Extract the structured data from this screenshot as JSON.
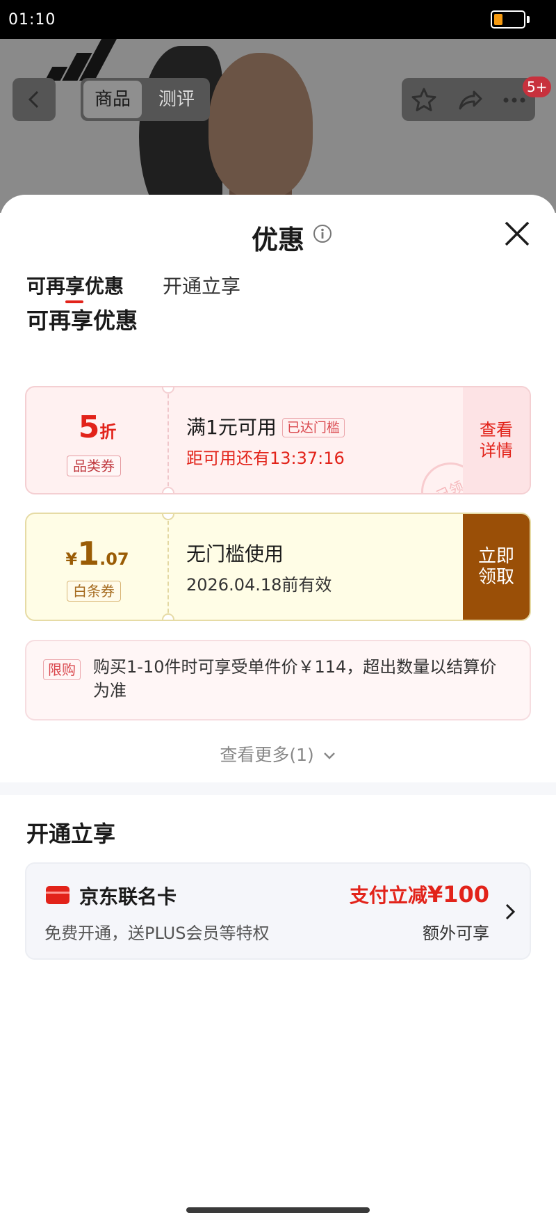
{
  "status_bar": {
    "time": "01:10"
  },
  "product_page": {
    "tabs": [
      "商品",
      "测评"
    ],
    "notification_count": "5+"
  },
  "sheet": {
    "title": "优惠",
    "tabs": [
      {
        "label": "可再享优惠",
        "active": true
      },
      {
        "label": "开通立享",
        "active": false
      }
    ],
    "section_reusable": {
      "title": "可再享优惠",
      "coupons": [
        {
          "value": "5",
          "value_unit": "折",
          "type_tag": "品类券",
          "condition": "满1元可用",
          "status_tag": "已达门槛",
          "countdown": "距可用还有13:37:16",
          "action": "查看详情",
          "action_line1": "查看",
          "action_line2": "详情",
          "stamp": "已领"
        },
        {
          "currency": "¥",
          "value_int": "1",
          "value_dec": ".07",
          "type_tag": "白条券",
          "condition": "无门槛使用",
          "validity": "2026.04.18前有效",
          "action": "立即领取",
          "action_line1": "立即",
          "action_line2": "领取"
        }
      ],
      "limit_notice": {
        "tag": "限购",
        "text": "购买1-10件时可享受单件价￥114，超出数量以结算价为准"
      },
      "see_more": "查看更多(1)"
    },
    "section_activate": {
      "title": "开通立享",
      "card": {
        "name": "京东联名卡",
        "description": "免费开通，送PLUS会员等特权",
        "promo_prefix": "支付立减",
        "promo_amount": "¥100",
        "promo_note": "额外可享"
      }
    }
  },
  "colors": {
    "accent_red": "#e2231a",
    "coupon_brown": "#9a4f07",
    "coupon_gold_bg": "#fffde6",
    "coupon_pink_bg": "#fff1f1"
  },
  "icons": [
    "back-icon",
    "star-icon",
    "share-icon",
    "more-icon",
    "info-icon",
    "close-icon",
    "chevron-down-icon",
    "card-icon",
    "chevron-right-icon"
  ]
}
